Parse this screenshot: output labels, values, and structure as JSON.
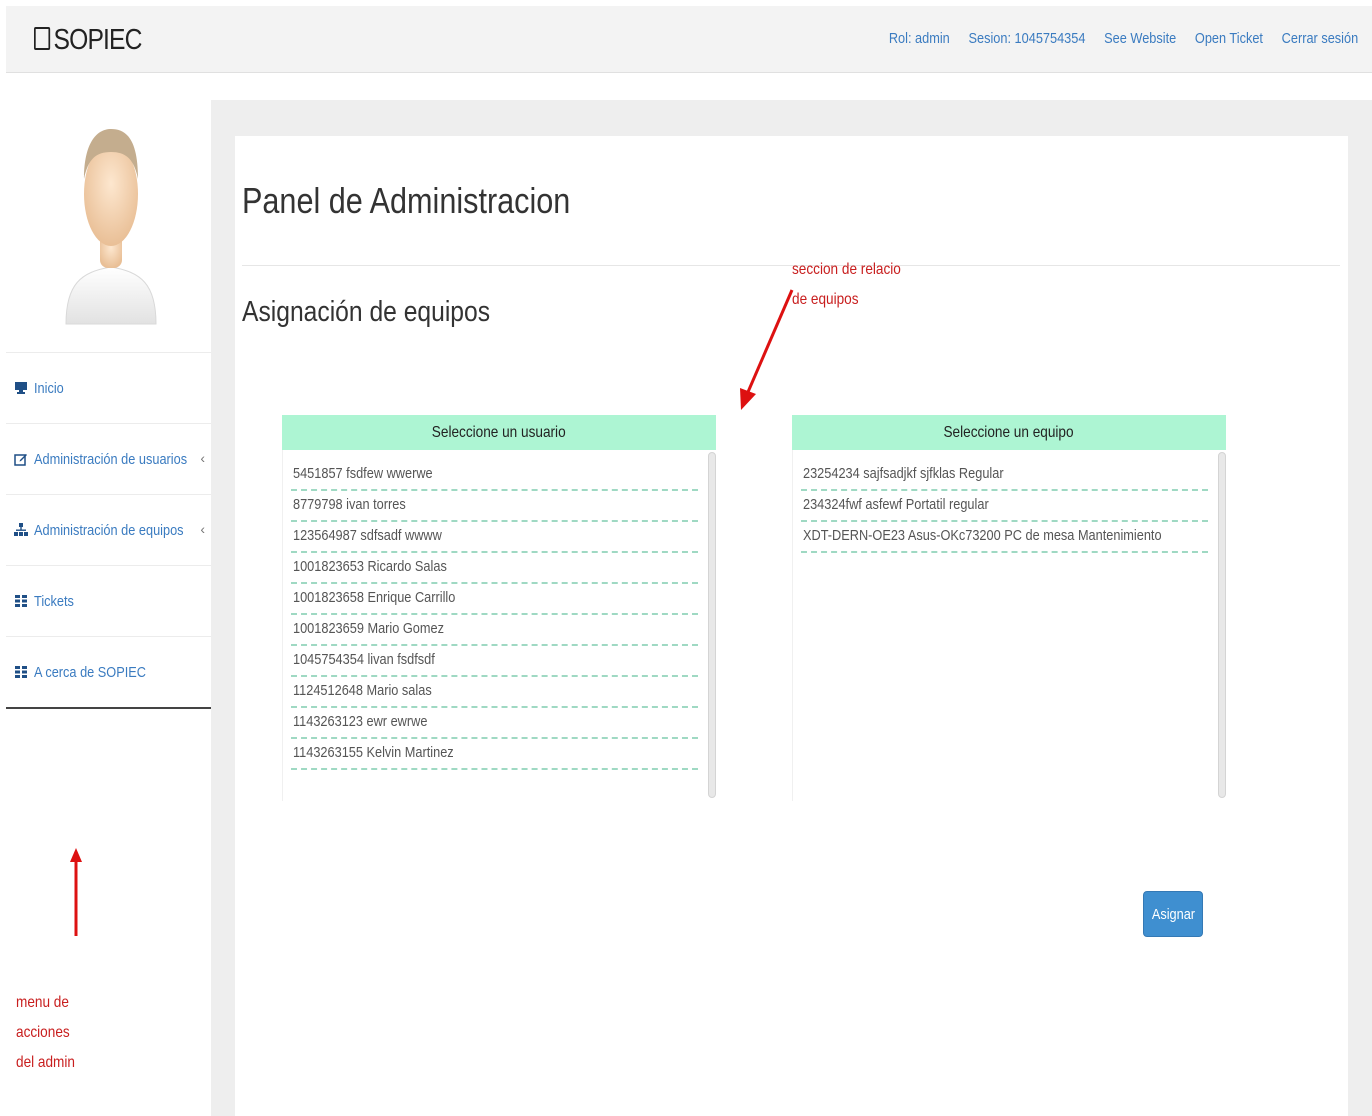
{
  "navbar": {
    "brand": "SOPIEC",
    "links": [
      "Rol: admin",
      "Sesion: 1045754354",
      "See Website",
      "Open Ticket",
      "Cerrar sesión"
    ]
  },
  "sidebar": {
    "items": [
      {
        "label": "Inicio",
        "icon": "monitor-icon",
        "has_chevron": false
      },
      {
        "label": "Administración de usuarios",
        "icon": "edit-icon",
        "has_chevron": true
      },
      {
        "label": "Administración de equipos",
        "icon": "sitemap-icon",
        "has_chevron": true
      },
      {
        "label": "Tickets",
        "icon": "grid-icon",
        "has_chevron": false
      },
      {
        "label": "A cerca de SOPIEC",
        "icon": "grid-icon",
        "has_chevron": false
      }
    ],
    "chevron": "‹"
  },
  "annotations": {
    "menu": [
      "menu de",
      "acciones",
      "del admin"
    ],
    "section": [
      "seccion de relacio",
      "de equipos"
    ],
    "color": "#c81e1e"
  },
  "main": {
    "title": "Panel de Administracion",
    "section_title": "Asignación de equipos",
    "users_panel": {
      "header": "Seleccione un usuario",
      "items": [
        "5451857 fsdfew wwerwe",
        "8779798 ivan torres",
        "123564987 sdfsadf wwww",
        "1001823653 Ricardo Salas",
        "1001823658 Enrique Carrillo",
        "1001823659 Mario Gomez",
        "1045754354 livan fsdfsdf",
        "1124512648 Mario salas",
        "1143263123 ewr ewrwe",
        "1143263155 Kelvin Martinez"
      ]
    },
    "equip_panel": {
      "header": "Seleccione un equipo",
      "items": [
        "23254234 sajfsadjkf sjfklas Regular",
        "234324fwf asfewf Portatil regular",
        "XDT-DERN-OE23 Asus-OKc73200 PC de mesa Mantenimiento"
      ]
    },
    "assign_button": "Asignar"
  },
  "colors": {
    "link": "#3a7bc0",
    "panel_header": "#adf5d3",
    "button": "#3f8fd0"
  }
}
